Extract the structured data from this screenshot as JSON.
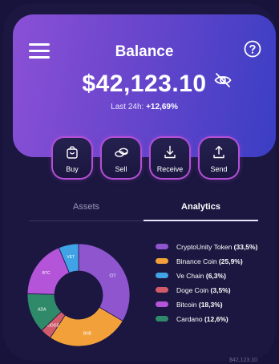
{
  "header": {
    "title": "Balance",
    "balance": "$42,123.10",
    "change_label": "Last 24h:",
    "change_value": "+12,69%"
  },
  "actions": [
    {
      "label": "Buy",
      "icon": "bag-icon"
    },
    {
      "label": "Sell",
      "icon": "coins-icon"
    },
    {
      "label": "Receive",
      "icon": "download-icon"
    },
    {
      "label": "Send",
      "icon": "upload-icon"
    }
  ],
  "tabs": [
    {
      "label": "Assets",
      "active": false
    },
    {
      "label": "Analytics",
      "active": true
    }
  ],
  "chart_data": {
    "type": "pie",
    "donut": true,
    "series": [
      {
        "name": "CryptoUnity Token",
        "short": "CIT",
        "value": 33.5,
        "pct": "(33,5%)",
        "color": "#8e55cf"
      },
      {
        "name": "Binance Coin",
        "short": "BNB",
        "value": 25.9,
        "pct": "(25,9%)",
        "color": "#f2a13a"
      },
      {
        "name": "Doge Coin",
        "short": "DOGE",
        "value": 3.5,
        "pct": "(3,5%)",
        "color": "#d15b6b"
      },
      {
        "name": "Cardano",
        "short": "ADA",
        "value": 12.6,
        "pct": "(12,6%)",
        "color": "#2f8a69"
      },
      {
        "name": "Bitcoin",
        "short": "BTC",
        "value": 18.3,
        "pct": "(18,3%)",
        "color": "#b454d9"
      },
      {
        "name": "Ve Chain",
        "short": "VET",
        "value": 6.3,
        "pct": "(6,3%)",
        "color": "#3fa3e6"
      }
    ],
    "legend_order": [
      "CryptoUnity Token",
      "Binance Coin",
      "Ve Chain",
      "Doge Coin",
      "Bitcoin",
      "Cardano"
    ]
  },
  "footer": {
    "amount": "$42,123.10"
  }
}
